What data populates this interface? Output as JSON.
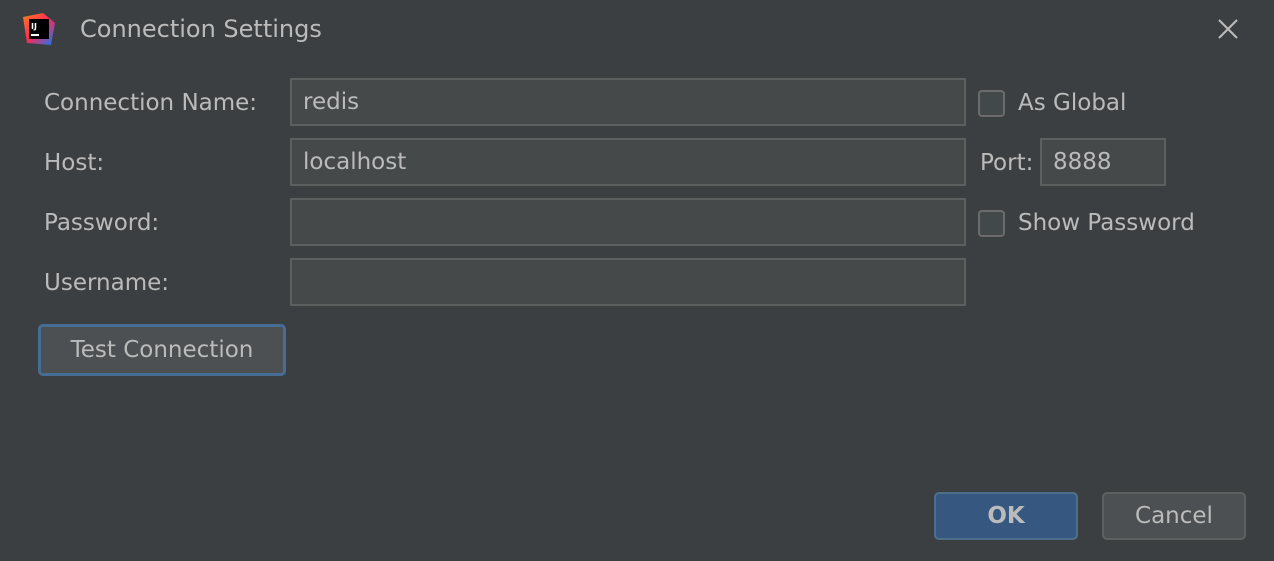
{
  "window": {
    "title": "Connection Settings",
    "app_icon": "intellij-idea-icon",
    "close_icon": "close-icon"
  },
  "form": {
    "connection_name": {
      "label": "Connection Name:",
      "value": ""
    },
    "host": {
      "label": "Host:",
      "value": "localhost"
    },
    "port": {
      "label": "Port:",
      "value": "8888"
    },
    "password": {
      "label": "Password:",
      "value": ""
    },
    "username": {
      "label": "Username:",
      "value": ""
    },
    "as_global": {
      "label": "As Global",
      "checked": false
    },
    "show_password": {
      "label": "Show Password",
      "checked": false
    }
  },
  "buttons": {
    "test_connection": "Test Connection",
    "ok": "OK",
    "cancel": "Cancel"
  },
  "colors": {
    "background": "#3c3f41",
    "field_background": "#45494a",
    "text": "#bbbbbb",
    "accent": "#365880",
    "focus_border": "#466d94"
  },
  "connection_name_value": "redis"
}
